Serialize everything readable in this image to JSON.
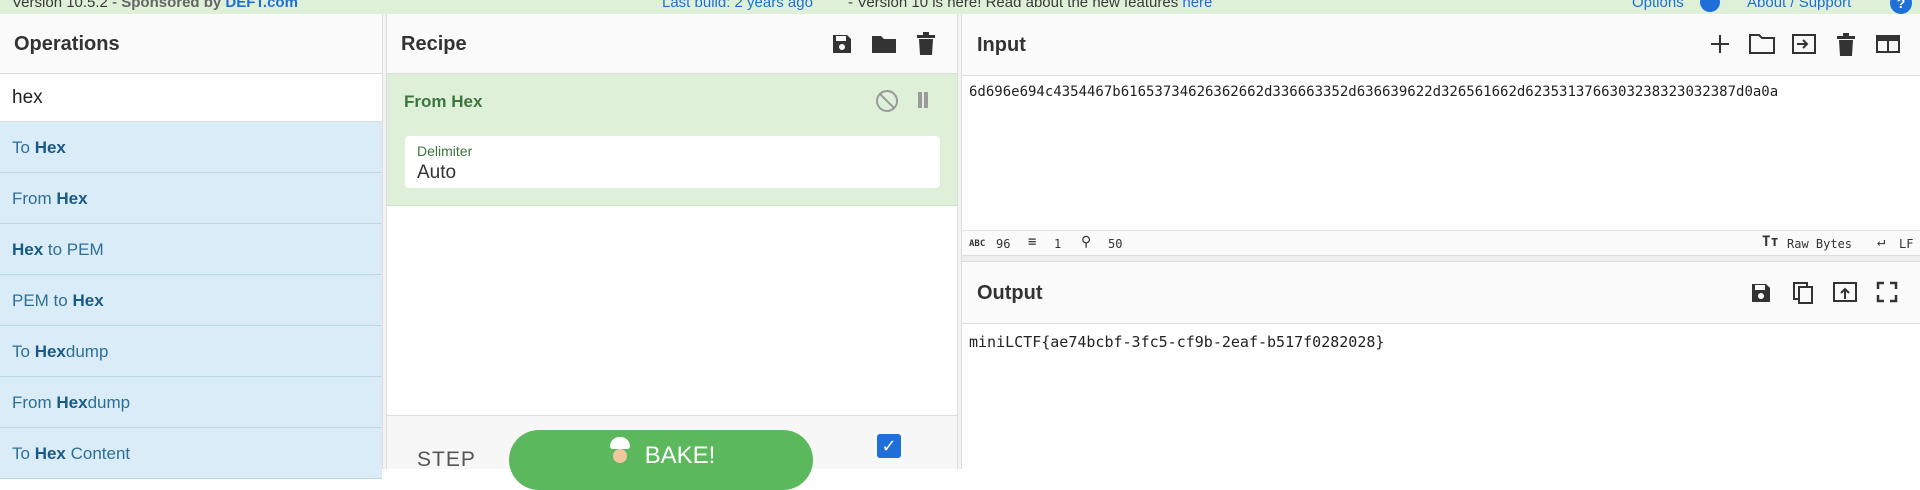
{
  "banner": {
    "version_text": "Version 10.5.2 - ",
    "sponsor_text": "Sponsored by ",
    "sponsor_link": "DEFT.com",
    "build_text": "Last build: 2 years ago",
    "news_text": " - Version 10 is here! Read about the new features ",
    "news_link": "here",
    "options_label": "Options",
    "about_label": "About / Support"
  },
  "operations": {
    "title": "Operations",
    "search_value": "hex",
    "items": [
      {
        "pre": "To ",
        "match": "Hex",
        "post": ""
      },
      {
        "pre": "From ",
        "match": "Hex",
        "post": ""
      },
      {
        "pre": "",
        "match": "Hex",
        "post": " to PEM"
      },
      {
        "pre": "PEM to ",
        "match": "Hex",
        "post": ""
      },
      {
        "pre": "To ",
        "match": "Hex",
        "post": "dump"
      },
      {
        "pre": "From ",
        "match": "Hex",
        "post": "dump"
      },
      {
        "pre": "To ",
        "match": "Hex",
        "post": " Content"
      }
    ]
  },
  "recipe": {
    "title": "Recipe",
    "operation": {
      "name": "From Hex",
      "arg_label": "Delimiter",
      "arg_value": "Auto"
    },
    "step_label": "STEP",
    "bake_label": "BAKE!",
    "auto_bake": true
  },
  "input": {
    "title": "Input",
    "value": "6d696e694c4354467b61653734626362662d336663352d636639622d326561662d6235313766303238323032387d0a0a",
    "status": {
      "length": "96",
      "lines": "1",
      "position": "50",
      "encoding": "Raw Bytes",
      "eol": "LF"
    }
  },
  "output": {
    "title": "Output",
    "value": "miniLCTF{ae74bcbf-3fc5-cf9b-2eaf-b517f0282028}"
  }
}
